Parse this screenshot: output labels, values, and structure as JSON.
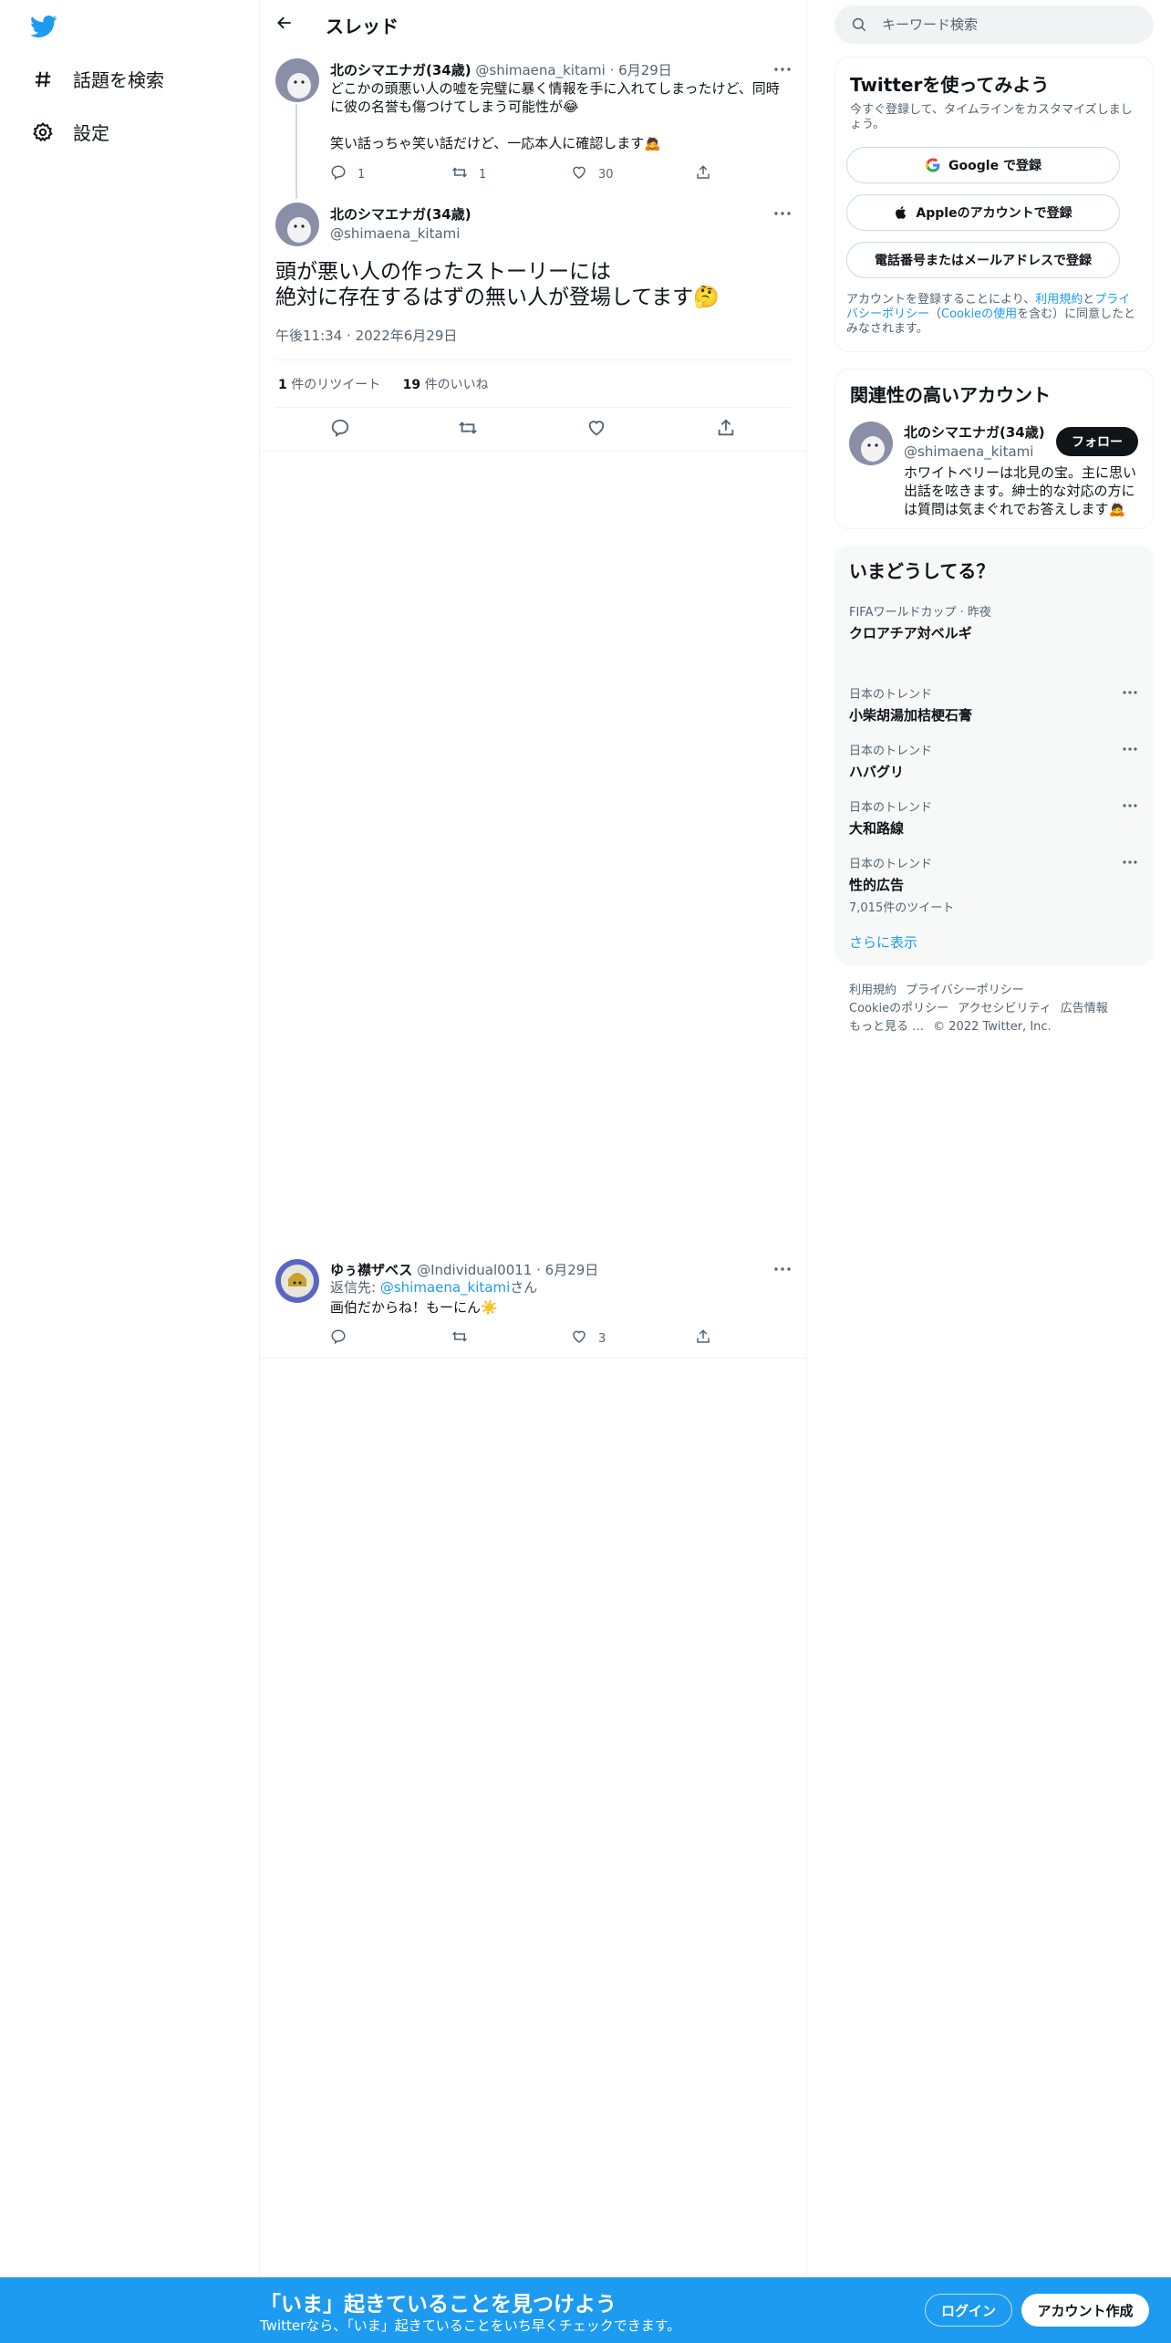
{
  "nav": {
    "logo": "twitter-bird-icon",
    "items": [
      {
        "label": "話題を検索",
        "icon": "hashtag-icon"
      },
      {
        "label": "設定",
        "icon": "gear-icon"
      }
    ]
  },
  "header": {
    "title": "スレッド"
  },
  "thread": {
    "parent": {
      "name": "北のシマエナガ(34歳)",
      "handle": "@shimaena_kitami",
      "dot": "·",
      "date": "6月29日",
      "text_line1": "どこかの頭悪い人の嘘を完璧に暴く情報を手に入れてしまったけど、同時",
      "text_line2": "に彼の名誉も傷つけてしまう可能性が😂",
      "text_line3": "笑い話っちゃ笑い話だけど、一応本人に確認します🙇",
      "replies": "1",
      "retweets": "1",
      "likes": "30"
    },
    "main": {
      "name": "北のシマエナガ(34歳)",
      "handle": "@shimaena_kitami",
      "text_line1": "頭が悪い人の作ったストーリーには",
      "text_line2": "絶対に存在するはずの無い人が登場してます🤔",
      "time": "午後11:34",
      "sep": "·",
      "date": "2022年6月29日",
      "retweet_count": "1",
      "retweet_label": " 件のリツイート",
      "like_count": "19",
      "like_label": " 件のいいね"
    },
    "reply": {
      "name": "ゆぅ襟ザベス",
      "handle": "@Individual0011",
      "dot": "·",
      "date": "6月29日",
      "reply_prefix": "返信先: ",
      "reply_mention": "@shimaena_kitami",
      "reply_suffix": "さん",
      "text": "画伯だからね！もーにん☀️",
      "likes": "3"
    }
  },
  "search": {
    "placeholder": "キーワード検索"
  },
  "signup_card": {
    "title": "Twitterを使ってみよう",
    "subtitle": "今すぐ登録して、タイムラインをカスタマイズしましょう。",
    "google": "Google で登録",
    "apple": "Appleのアカウントで登録",
    "phone": "電話番号またはメールアドレスで登録",
    "legal_1": "アカウントを登録することにより、",
    "legal_terms": "利用規約",
    "legal_2": "と",
    "legal_privacy": "プライバシーポリシー",
    "legal_3": "（",
    "legal_cookie": "Cookieの使用",
    "legal_4": "を含む）に同意したとみなされます。"
  },
  "related": {
    "title": "関連性の高いアカウント",
    "name": "北のシマエナガ(34歳)",
    "handle": "@shimaena_kitami",
    "follow": "フォロー",
    "bio": "ホワイトベリーは北見の宝。主に思い出話を呟きます。紳士的な対応の方には質問は気まぐれでお答えします🙇"
  },
  "trends": {
    "title": "いまどうしてる？",
    "items": [
      {
        "context": "FIFAワールドカップ · 昨夜",
        "name": "クロアチア対ベルギ",
        "count": ""
      },
      {
        "context": "日本のトレンド",
        "name": "小柴胡湯加桔梗石膏",
        "count": ""
      },
      {
        "context": "日本のトレンド",
        "name": "ハバグリ",
        "count": ""
      },
      {
        "context": "日本のトレンド",
        "name": "大和路線",
        "count": ""
      },
      {
        "context": "日本のトレンド",
        "name": "性的広告",
        "count": "7,015件のツイート"
      }
    ],
    "show_more": "さらに表示"
  },
  "footer": {
    "links": [
      "利用規約",
      "プライバシーポリシー",
      "Cookieのポリシー",
      "アクセシビリティ",
      "広告情報",
      "もっと見る …"
    ],
    "copyright": "© 2022 Twitter, Inc."
  },
  "bottom_bar": {
    "title": "「いま」起きていることを見つけよう",
    "subtitle": "Twitterなら、「いま」起きていることをいち早くチェックできます。",
    "login": "ログイン",
    "signup": "アカウント作成"
  },
  "colors": {
    "accent": "#1d9bf0",
    "text": "#0f1419",
    "muted": "#536471",
    "border": "#eff3f4"
  }
}
